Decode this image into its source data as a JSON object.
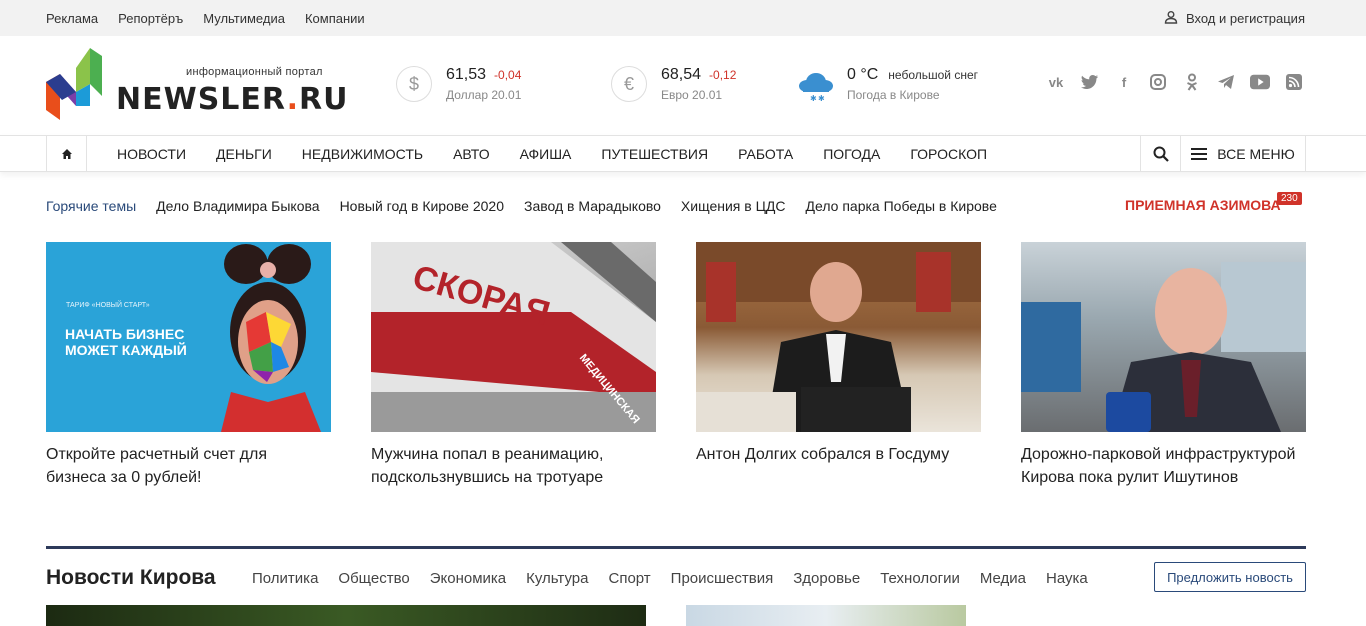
{
  "topbar": {
    "links": [
      "Реклама",
      "Репортёръ",
      "Мультимедиа",
      "Компании"
    ],
    "login": "Вход и регистрация"
  },
  "logo": {
    "tagline": "информационный портал",
    "name": "NEWSLER",
    "dot": ".",
    "tld": "RU"
  },
  "rates": [
    {
      "symbol": "$",
      "value": "61,53",
      "change": "-0,04",
      "label": "Доллар 20.01"
    },
    {
      "symbol": "€",
      "value": "68,54",
      "change": "-0,12",
      "label": "Евро 20.01"
    }
  ],
  "weather": {
    "temp": "0 °C",
    "desc": "небольшой снег",
    "label": "Погода в Кирове",
    "icon": "cloud-snow-icon"
  },
  "socials": [
    "vk-icon",
    "twitter-icon",
    "facebook-icon",
    "instagram-icon",
    "odnoklassniki-icon",
    "telegram-icon",
    "youtube-icon",
    "rss-icon"
  ],
  "nav": {
    "items": [
      "НОВОСТИ",
      "ДЕНЬГИ",
      "НЕДВИЖИМОСТЬ",
      "АВТО",
      "АФИША",
      "ПУТЕШЕСТВИЯ",
      "РАБОТА",
      "ПОГОДА",
      "ГОРОСКОП"
    ],
    "all_menu": "ВСЕ МЕНЮ"
  },
  "hot": {
    "label": "Горячие темы",
    "topics": [
      "Дело Владимира Быкова",
      "Новый год в Кирове 2020",
      "Завод в Марадыково",
      "Хищения в ЦДС",
      "Дело парка Победы в Кирове"
    ],
    "priem": "ПРИЕМНАЯ АЗИМОВА",
    "badge": "230"
  },
  "cards": [
    {
      "title": "Откройте расчетный счет для бизнеса за 0 рублей!",
      "img_small": "ТАРИФ «НОВЫЙ СТАРТ»",
      "img_big": "НАЧАТЬ БИЗНЕС МОЖЕТ КАЖДЫЙ"
    },
    {
      "title": "Мужчина попал в реанимацию, подскользнувшись на тротуаре",
      "img_text": "СКОРАЯ",
      "img_text2": "МЕДИЦИНСКАЯ"
    },
    {
      "title": "Антон Долгих собрался в Госдуму"
    },
    {
      "title": "Дорожно-парковой инфраструктурой Кирова пока рулит Ишутинов"
    }
  ],
  "section": {
    "title": "Новости Кирова",
    "categories": [
      "Политика",
      "Общество",
      "Экономика",
      "Культура",
      "Спорт",
      "Происшествия",
      "Здоровье",
      "Технологии",
      "Медиа",
      "Наука"
    ],
    "suggest": "Предложить новость"
  },
  "colors": {
    "accent_red": "#d0332a",
    "nav_blue": "#2a4a7a",
    "section_line": "#2d3a5a"
  }
}
